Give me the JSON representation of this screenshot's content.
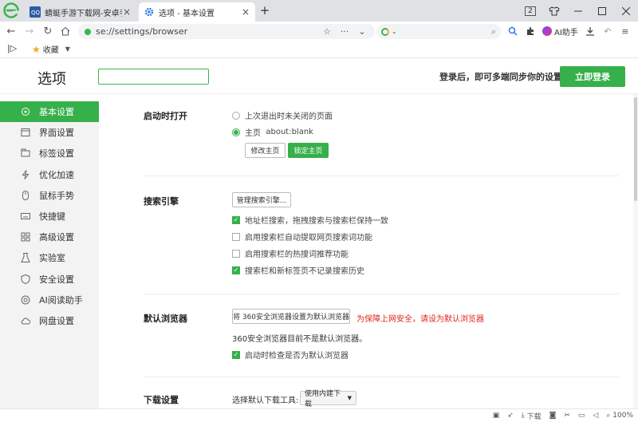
{
  "browser": {
    "tabs": [
      {
        "label": "蜻蜓手游下载网-安卓手游下",
        "active": false
      },
      {
        "label": "选项 - 基本设置",
        "active": true
      }
    ],
    "window_controls": [
      "2",
      "shirt-icon",
      "minimize",
      "maximize",
      "close"
    ],
    "address": {
      "url": "se://settings/browser"
    },
    "search": {
      "placeholder": ""
    },
    "toolbar": {
      "ai_label": "AI助手"
    },
    "bookmarks": {
      "favorites_label": "收藏"
    }
  },
  "header": {
    "title": "选项",
    "search_value": "",
    "sync_hint": "登录后，即可多端同步你的设置",
    "login_button": "立即登录"
  },
  "sidebar": {
    "items": [
      {
        "label": "基本设置",
        "icon": "settings-icon",
        "active": true
      },
      {
        "label": "界面设置",
        "icon": "window-icon",
        "active": false
      },
      {
        "label": "标签设置",
        "icon": "tab-icon",
        "active": false
      },
      {
        "label": "优化加速",
        "icon": "lightning-icon",
        "active": false
      },
      {
        "label": "鼠标手势",
        "icon": "mouse-icon",
        "active": false
      },
      {
        "label": "快捷键",
        "icon": "keyboard-icon",
        "active": false
      },
      {
        "label": "高级设置",
        "icon": "advanced-icon",
        "active": false
      },
      {
        "label": "实验室",
        "icon": "lab-icon",
        "active": false
      },
      {
        "label": "安全设置",
        "icon": "shield-icon",
        "active": false
      },
      {
        "label": "AI阅读助手",
        "icon": "ai-icon",
        "active": false
      },
      {
        "label": "网盘设置",
        "icon": "cloud-icon",
        "active": false
      }
    ]
  },
  "sections": {
    "startup": {
      "label": "启动时打开",
      "option1": "上次退出时未关闭的页面",
      "option2_prefix": "主页",
      "option2_value": "about:blank",
      "modify_button": "修改主页",
      "lock_button": "锁定主页"
    },
    "search_engine": {
      "label": "搜索引擎",
      "manage_button": "管理搜索引擎...",
      "options": [
        {
          "label": "地址栏搜索，拖拽搜索与搜索栏保持一致",
          "checked": true
        },
        {
          "label": "启用搜索栏自动提取网页搜索词功能",
          "checked": false
        },
        {
          "label": "启用搜索栏的热搜词推荐功能",
          "checked": false
        },
        {
          "label": "搜索栏和新标签页不记录搜索历史",
          "checked": true
        }
      ]
    },
    "default_browser": {
      "label": "默认浏览器",
      "set_button": "将 360安全浏览器设置为默认浏览器",
      "warning": "为保障上网安全，请设为默认浏览器",
      "status": "360安全浏览器目前不是默认浏览器。",
      "check_option": {
        "label": "启动时检查是否为默认浏览器",
        "checked": true
      }
    },
    "download": {
      "label": "下载设置",
      "tool_label": "选择默认下载工具:",
      "tool_value": "使用内建下载"
    }
  },
  "statusbar": {
    "download_label": "下载",
    "zoom": "100%"
  },
  "colors": {
    "accent": "#36b04a",
    "warning": "#e0241b"
  }
}
